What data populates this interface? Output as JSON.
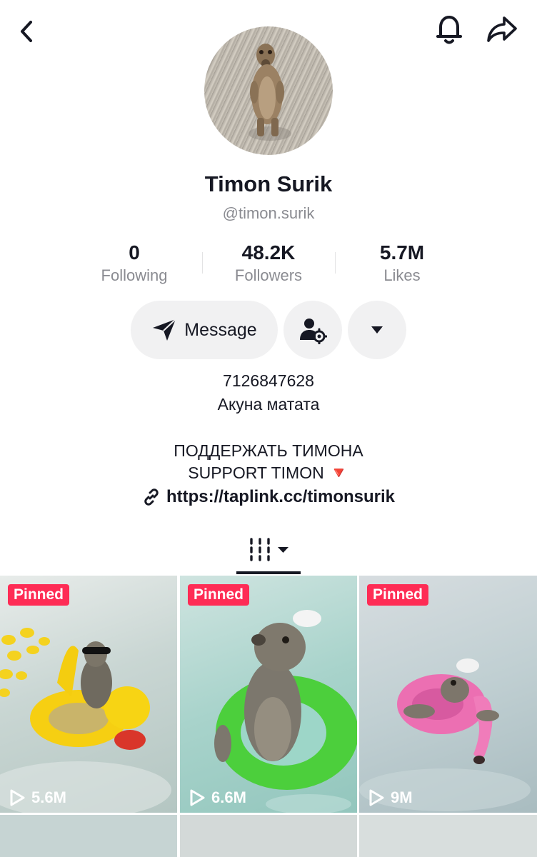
{
  "header": {
    "back_icon": "chevron-left-icon",
    "notification_icon": "bell-icon",
    "share_icon": "share-arrow-icon"
  },
  "profile": {
    "display_name": "Timon Surik",
    "username": "@timon.surik",
    "stats": [
      {
        "value": "0",
        "label": "Following"
      },
      {
        "value": "48.2K",
        "label": "Followers"
      },
      {
        "value": "5.7M",
        "label": "Likes"
      }
    ]
  },
  "actions": {
    "message_label": "Message",
    "message_icon": "send-icon",
    "friend_icon": "user-settings-icon",
    "more_icon": "caret-down-icon"
  },
  "bio": {
    "line1": "7126847628",
    "line2": "Акуна матата",
    "line3": "ПОДДЕРЖАТЬ ТИМОНА",
    "line4": "SUPPORT TIMON 🔻",
    "link": "https://taplink.cc/timonsurik"
  },
  "tabs": {
    "videos_icon": "grid-icon"
  },
  "videos": [
    {
      "badge": "Pinned",
      "views": "5.6M"
    },
    {
      "badge": "Pinned",
      "views": "6.6M"
    },
    {
      "badge": "Pinned",
      "views": "9M"
    }
  ],
  "colors": {
    "accent": "#fe2c55",
    "secondary_text": "#8a8b91",
    "button_bg": "#f1f1f2"
  }
}
